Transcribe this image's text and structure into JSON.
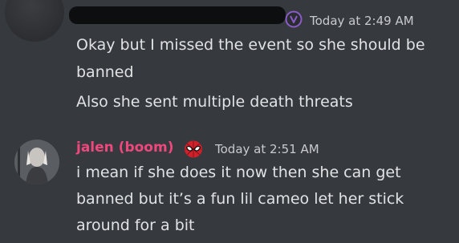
{
  "messages": [
    {
      "timestamp": "Today at 2:49 AM",
      "lines": [
        "Okay but I missed the event so she should be",
        "banned",
        "Also she sent multiple death threats"
      ]
    },
    {
      "username": "jalen (boom)",
      "timestamp": "Today at 2:51 AM",
      "lines": [
        "i mean if she does it now then she can get",
        "banned but it’s a fun lil cameo let her stick",
        "around for a bit"
      ]
    }
  ],
  "colors": {
    "background": "#36393e",
    "username": "#f0477c",
    "text": "#e1e2e4",
    "timestamp": "#c9cacd",
    "role_icon": "#8a5cc8"
  },
  "icons": {
    "role_badge": "role-badge-icon",
    "spider_badge": "spiderman-badge-icon"
  }
}
